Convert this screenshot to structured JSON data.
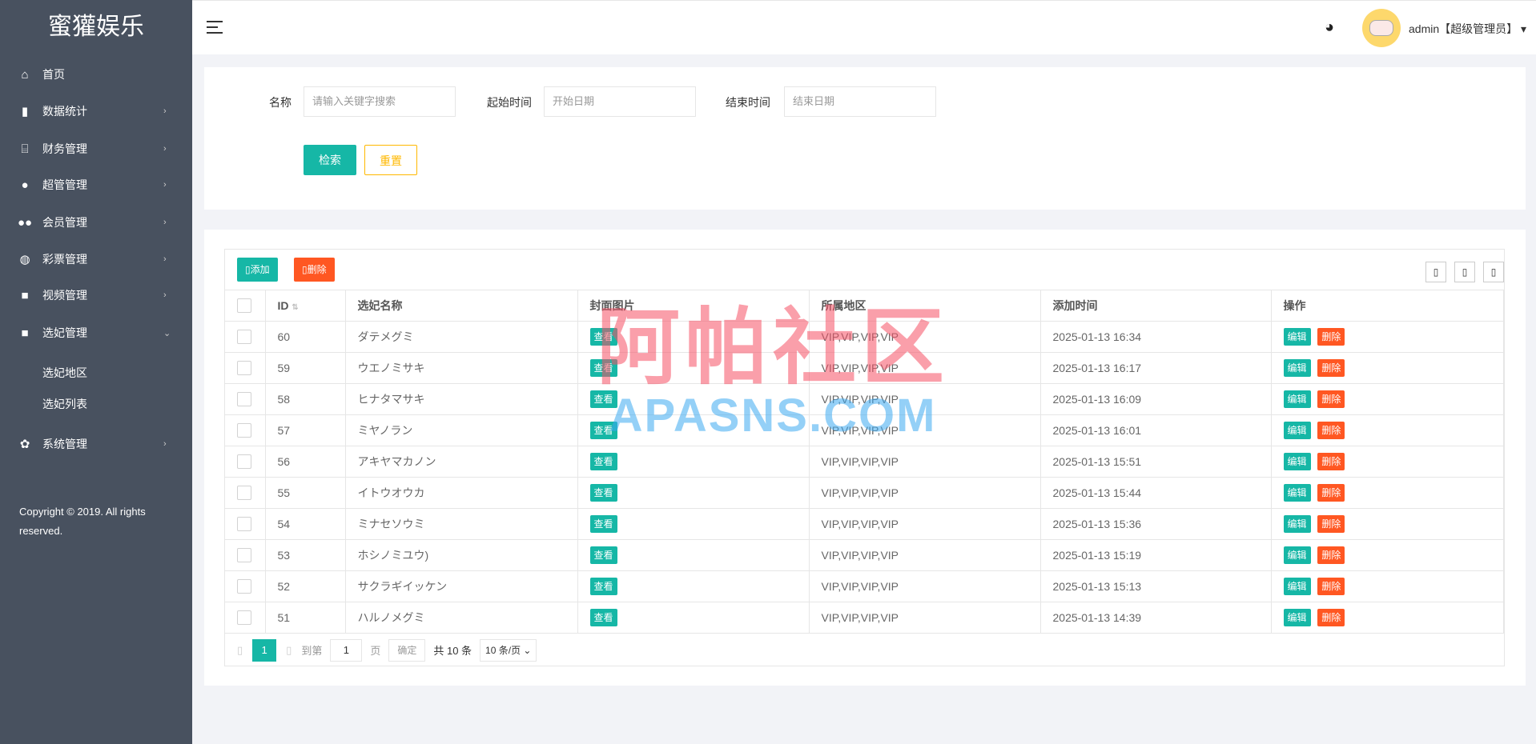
{
  "sidebar": {
    "logo": "蜜獾娱乐",
    "items": [
      {
        "icon": "home",
        "label": "首页",
        "glyph": "⌂",
        "arrow": ""
      },
      {
        "icon": "chart",
        "label": "数据统计",
        "glyph": "▮",
        "arrow": "›"
      },
      {
        "icon": "bank",
        "label": "财务管理",
        "glyph": "⌸",
        "arrow": "›"
      },
      {
        "icon": "user",
        "label": "超管管理",
        "glyph": "●",
        "arrow": "›"
      },
      {
        "icon": "users",
        "label": "会员管理",
        "glyph": "●●",
        "arrow": "›"
      },
      {
        "icon": "gamepad",
        "label": "彩票管理",
        "glyph": "◍",
        "arrow": "›"
      },
      {
        "icon": "video",
        "label": "视频管理",
        "glyph": "■",
        "arrow": "›"
      },
      {
        "icon": "video",
        "label": "选妃管理",
        "glyph": "■",
        "arrow": "⌄"
      },
      {
        "icon": "",
        "label": "选妃地区",
        "glyph": "",
        "arrow": ""
      },
      {
        "icon": "",
        "label": "选妃列表",
        "glyph": "",
        "arrow": ""
      },
      {
        "icon": "gear",
        "label": "系统管理",
        "glyph": "✿",
        "arrow": "›"
      }
    ],
    "copyright": "Copyright © 2019. All rights reserved."
  },
  "header": {
    "username": "admin【超级管理员】",
    "caret": "▾",
    "palette": "🎨"
  },
  "search": {
    "name_label": "名称",
    "name_placeholder": "请输入关键字搜索",
    "start_label": "起始时间",
    "start_placeholder": "开始日期",
    "end_label": "结束时间",
    "end_placeholder": "结束日期",
    "search_btn": "检索",
    "reset_btn": "重置"
  },
  "toolbar": {
    "add": "添加",
    "delete": "删除",
    "icon_glyph": "▯"
  },
  "table": {
    "columns": [
      "ID",
      "选妃名称",
      "封面图片",
      "所属地区",
      "添加时间",
      "操作"
    ],
    "view_label": "查看",
    "edit_label": "编辑",
    "delete_label": "删除",
    "rows": [
      {
        "id": "60",
        "name": "ダテメグミ",
        "region": "VIP,VIP,VIP,VIP",
        "time": "2025-01-13 16:34"
      },
      {
        "id": "59",
        "name": "ウエノミサキ",
        "region": "VIP,VIP,VIP,VIP",
        "time": "2025-01-13 16:17"
      },
      {
        "id": "58",
        "name": "ヒナタマサキ",
        "region": "VIP,VIP,VIP,VIP",
        "time": "2025-01-13 16:09"
      },
      {
        "id": "57",
        "name": "ミヤノラン",
        "region": "VIP,VIP,VIP,VIP",
        "time": "2025-01-13 16:01"
      },
      {
        "id": "56",
        "name": "アキヤマカノン",
        "region": "VIP,VIP,VIP,VIP",
        "time": "2025-01-13 15:51"
      },
      {
        "id": "55",
        "name": "イトウオウカ",
        "region": "VIP,VIP,VIP,VIP",
        "time": "2025-01-13 15:44"
      },
      {
        "id": "54",
        "name": "ミナセソウミ",
        "region": "VIP,VIP,VIP,VIP",
        "time": "2025-01-13 15:36"
      },
      {
        "id": "53",
        "name": "ホシノミユウ)",
        "region": "VIP,VIP,VIP,VIP",
        "time": "2025-01-13 15:19"
      },
      {
        "id": "52",
        "name": "サクラギイッケン",
        "region": "VIP,VIP,VIP,VIP",
        "time": "2025-01-13 15:13"
      },
      {
        "id": "51",
        "name": "ハルノメグミ",
        "region": "VIP,VIP,VIP,VIP",
        "time": "2025-01-13 14:39"
      }
    ]
  },
  "pagination": {
    "current": "1",
    "goto_label": "到第",
    "goto_value": "1",
    "page_label": "页",
    "confirm": "确定",
    "total": "共 10 条",
    "per_page": "10 条/页",
    "prev": "▯",
    "next": "▯"
  },
  "watermark": {
    "line1": "阿帕社区",
    "line2": "APASNS.COM"
  },
  "colors": {
    "sidebar": "#48515f",
    "accent": "#16b7a6",
    "danger": "#ff5722",
    "warning": "#ffb800"
  }
}
